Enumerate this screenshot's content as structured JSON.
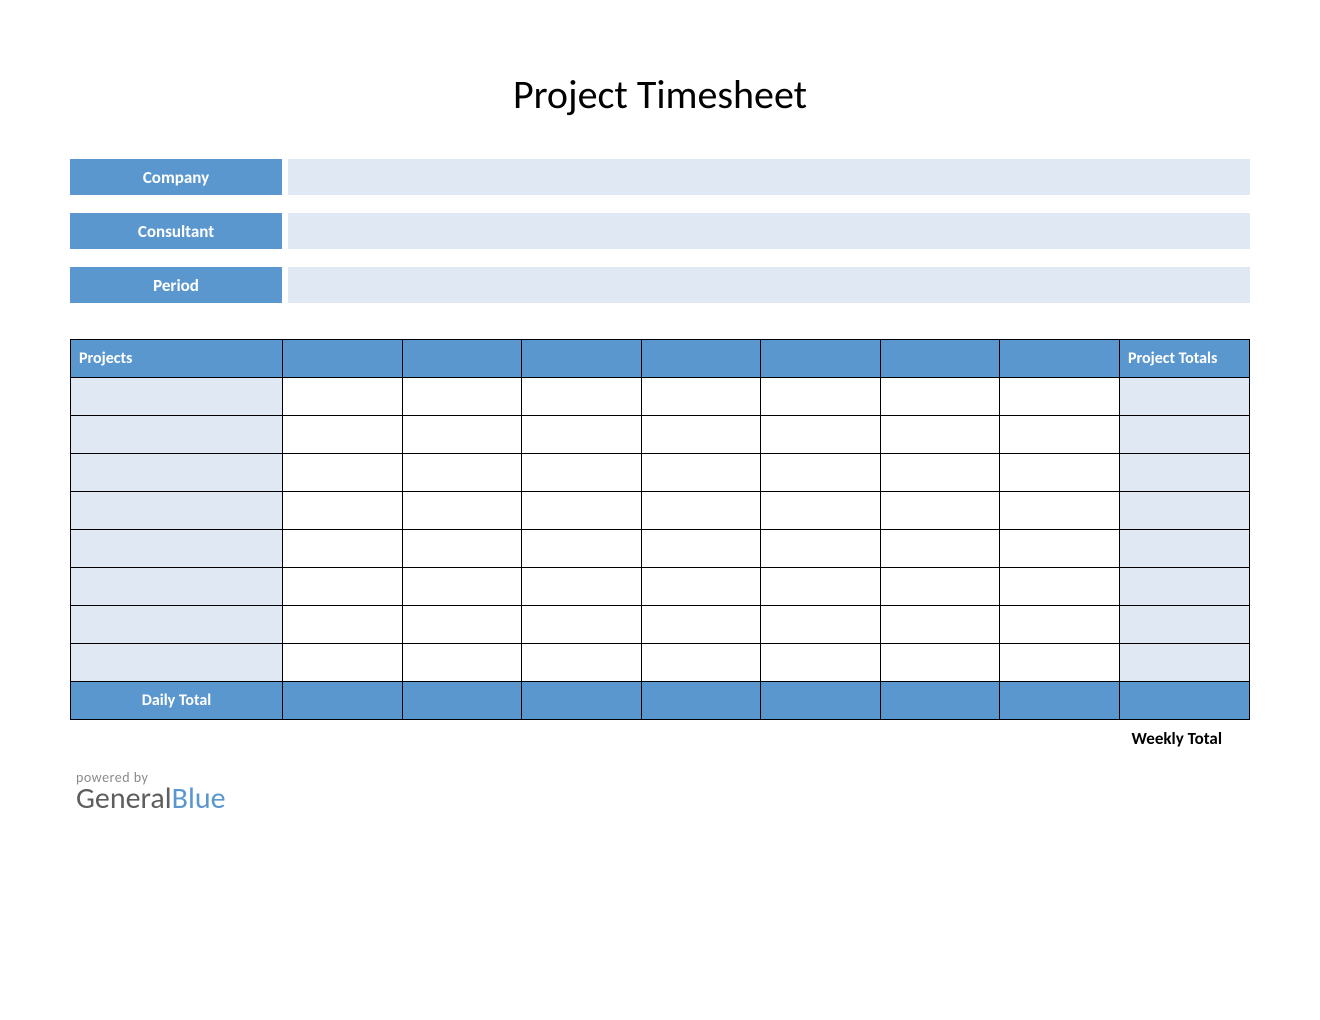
{
  "title": "Project Timesheet",
  "info": {
    "company_label": "Company",
    "company_value": "",
    "consultant_label": "Consultant",
    "consultant_value": "",
    "period_label": "Period",
    "period_value": ""
  },
  "table": {
    "header_projects": "Projects",
    "header_days": [
      "",
      "",
      "",
      "",
      "",
      "",
      ""
    ],
    "header_totals": "Project Totals",
    "rows": [
      {
        "project": "",
        "days": [
          "",
          "",
          "",
          "",
          "",
          "",
          ""
        ],
        "total": ""
      },
      {
        "project": "",
        "days": [
          "",
          "",
          "",
          "",
          "",
          "",
          ""
        ],
        "total": ""
      },
      {
        "project": "",
        "days": [
          "",
          "",
          "",
          "",
          "",
          "",
          ""
        ],
        "total": ""
      },
      {
        "project": "",
        "days": [
          "",
          "",
          "",
          "",
          "",
          "",
          ""
        ],
        "total": ""
      },
      {
        "project": "",
        "days": [
          "",
          "",
          "",
          "",
          "",
          "",
          ""
        ],
        "total": ""
      },
      {
        "project": "",
        "days": [
          "",
          "",
          "",
          "",
          "",
          "",
          ""
        ],
        "total": ""
      },
      {
        "project": "",
        "days": [
          "",
          "",
          "",
          "",
          "",
          "",
          ""
        ],
        "total": ""
      },
      {
        "project": "",
        "days": [
          "",
          "",
          "",
          "",
          "",
          "",
          ""
        ],
        "total": ""
      }
    ],
    "daily_total_label": "Daily Total",
    "daily_totals": [
      "",
      "",
      "",
      "",
      "",
      "",
      ""
    ],
    "daily_grand": ""
  },
  "weekly_total_label": "Weekly Total",
  "footer": {
    "powered_by": "powered by",
    "brand_part1": "General",
    "brand_part2": "Blue"
  },
  "colors": {
    "header_blue": "#5a97cf",
    "light_blue": "#dfe8f3"
  }
}
